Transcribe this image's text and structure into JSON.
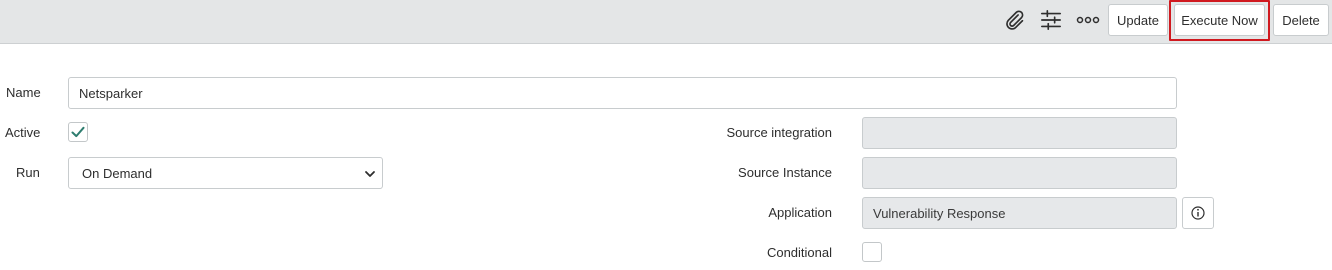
{
  "toolbar": {
    "icons": [
      "paperclip-icon",
      "sliders-icon",
      "more-icon"
    ],
    "update_label": "Update",
    "execute_label": "Execute Now",
    "delete_label": "Delete"
  },
  "form": {
    "name_label": "Name",
    "name_value": "Netsparker",
    "active_label": "Active",
    "active_checked": true,
    "run_label": "Run",
    "run_value": "On Demand",
    "source_integration_label": "Source integration",
    "source_integration_value": "",
    "source_instance_label": "Source Instance",
    "source_instance_value": "",
    "application_label": "Application",
    "application_value": "Vulnerability Response",
    "conditional_label": "Conditional",
    "conditional_checked": false
  },
  "colors": {
    "toolbar_bg": "#e4e6e7",
    "highlight_border": "#d0191f",
    "checkmark": "#2e7d6f",
    "readonly_bg": "#e6e8ea"
  }
}
